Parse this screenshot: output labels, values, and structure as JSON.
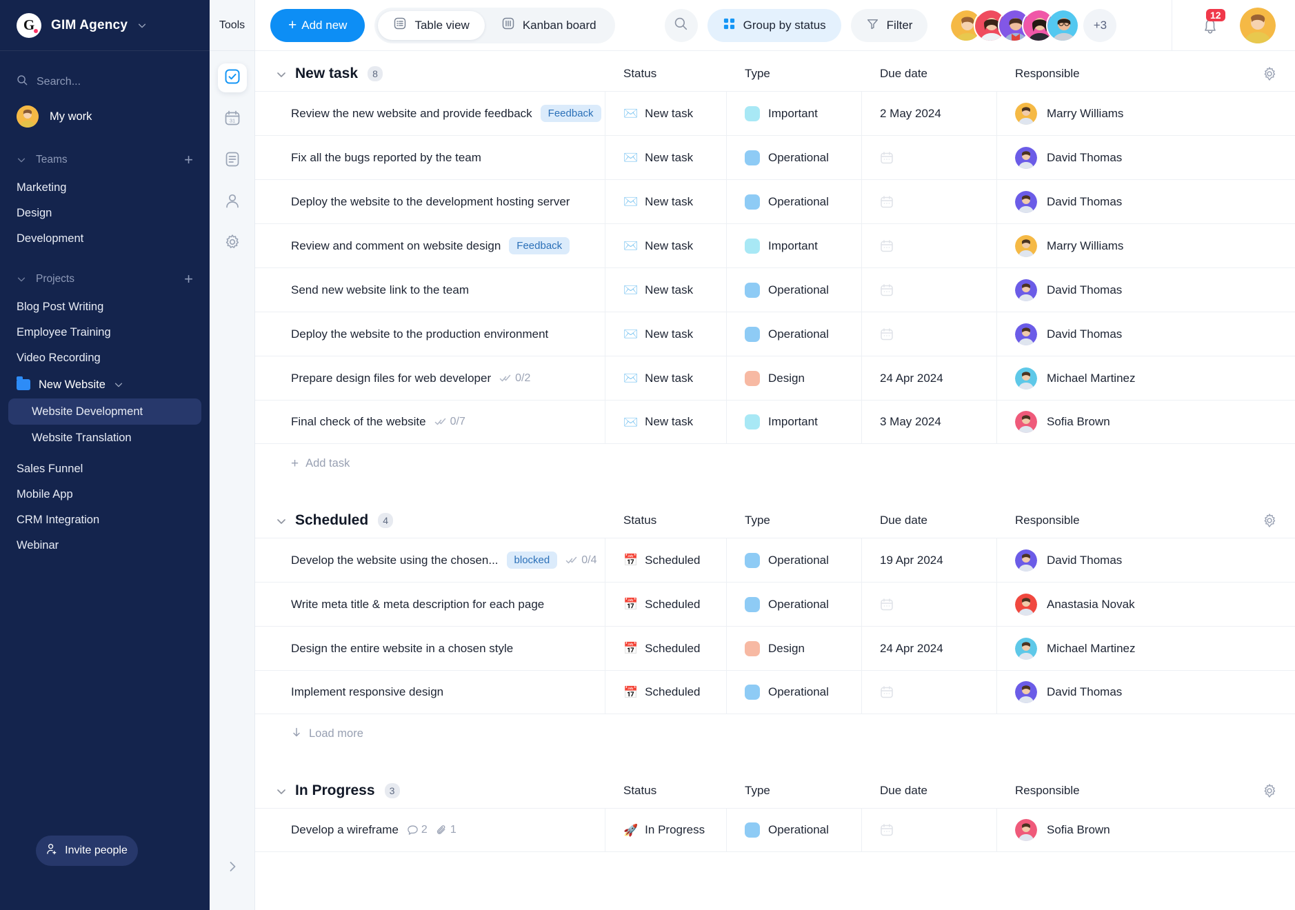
{
  "sidebar": {
    "brand": {
      "logo_letter": "G",
      "name": "GIM Agency",
      "chevron": "chevron-down-icon"
    },
    "search_placeholder": "Search...",
    "my_work": "My work",
    "teams": {
      "title": "Teams",
      "add": "+",
      "items": [
        "Marketing",
        "Design",
        "Development"
      ]
    },
    "projects": {
      "title": "Projects",
      "add": "+",
      "items": [
        "Blog Post Writing",
        "Employee Training",
        "Video Recording"
      ],
      "folder": {
        "name": "New Website",
        "children": [
          "Website Development",
          "Website Translation"
        ],
        "active_child": "Website Development"
      },
      "items_after": [
        "Sales Funnel",
        "Mobile App",
        "CRM Integration",
        "Webinar"
      ]
    },
    "invite_label": "Invite people"
  },
  "rail": {
    "title": "Tools",
    "items": [
      {
        "name": "tasks-icon",
        "selected": true
      },
      {
        "name": "calendar-icon",
        "selected": false
      },
      {
        "name": "document-icon",
        "selected": false
      },
      {
        "name": "person-icon",
        "selected": false
      },
      {
        "name": "settings-icon",
        "selected": false
      }
    ],
    "expand": "chevron-right-icon"
  },
  "topbar": {
    "add_new": "Add new",
    "views": [
      {
        "label": "Table view",
        "icon": "table-view-icon",
        "active": true
      },
      {
        "label": "Kanban board",
        "icon": "kanban-icon",
        "active": false
      }
    ],
    "search_icon": "search-icon",
    "group_by": "Group by status",
    "filter": "Filter",
    "avatars_overflow": "+3",
    "notifications_count": "12"
  },
  "columns": {
    "status": "Status",
    "type": "Type",
    "due": "Due date",
    "responsible": "Responsible",
    "settings_icon": "gear-icon"
  },
  "groups": [
    {
      "name": "New task",
      "count": "8",
      "footer": {
        "type": "add",
        "label": "Add task"
      },
      "rows": [
        {
          "task": "Review the new website and provide feedback",
          "tag": "Feedback",
          "status": "New task",
          "status_emoji": "✉️",
          "type": "Important",
          "type_color": "#a8e8f5",
          "due": "2 May 2024",
          "responsible": "Marry Williams",
          "avatar_color": "#f5b945"
        },
        {
          "task": "Fix all the bugs reported by the team",
          "status": "New task",
          "status_emoji": "✉️",
          "type": "Operational",
          "type_color": "#8ecbf5",
          "due": "",
          "responsible": "David Thomas",
          "avatar_color": "#6b5ce7"
        },
        {
          "task": "Deploy the website to the development hosting server",
          "status": "New task",
          "status_emoji": "✉️",
          "type": "Operational",
          "type_color": "#8ecbf5",
          "due": "",
          "responsible": "David Thomas",
          "avatar_color": "#6b5ce7"
        },
        {
          "task": "Review and comment on website design",
          "tag": "Feedback",
          "status": "New task",
          "status_emoji": "✉️",
          "type": "Important",
          "type_color": "#a8e8f5",
          "due": "",
          "responsible": "Marry Williams",
          "avatar_color": "#f5b945"
        },
        {
          "task": "Send new website link to the team",
          "status": "New task",
          "status_emoji": "✉️",
          "type": "Operational",
          "type_color": "#8ecbf5",
          "due": "",
          "responsible": "David Thomas",
          "avatar_color": "#6b5ce7"
        },
        {
          "task": "Deploy the website to the production environment",
          "status": "New task",
          "status_emoji": "✉️",
          "type": "Operational",
          "type_color": "#8ecbf5",
          "due": "",
          "responsible": "David Thomas",
          "avatar_color": "#6b5ce7"
        },
        {
          "task": "Prepare design files for web developer",
          "subtasks": "0/2",
          "status": "New task",
          "status_emoji": "✉️",
          "type": "Design",
          "type_color": "#f7b9a3",
          "due": "24 Apr 2024",
          "responsible": "Michael Martinez",
          "avatar_color": "#5ec8e8"
        },
        {
          "task": "Final check of the website",
          "subtasks": "0/7",
          "status": "New task",
          "status_emoji": "✉️",
          "type": "Important",
          "type_color": "#a8e8f5",
          "due": "3 May 2024",
          "responsible": "Sofia Brown",
          "avatar_color": "#ef5a7a"
        }
      ]
    },
    {
      "name": "Scheduled",
      "count": "4",
      "footer": {
        "type": "load",
        "label": "Load more"
      },
      "rows": [
        {
          "task": "Develop the website using the chosen...",
          "tag": "blocked",
          "subtasks": "0/4",
          "status": "Scheduled",
          "status_emoji": "📅",
          "type": "Operational",
          "type_color": "#8ecbf5",
          "due": "19 Apr 2024",
          "responsible": "David Thomas",
          "avatar_color": "#6b5ce7"
        },
        {
          "task": "Write meta title & meta description for each page",
          "status": "Scheduled",
          "status_emoji": "📅",
          "type": "Operational",
          "type_color": "#8ecbf5",
          "due": "",
          "responsible": "Anastasia Novak",
          "avatar_color": "#f0483f"
        },
        {
          "task": "Design the entire website in a chosen style",
          "status": "Scheduled",
          "status_emoji": "📅",
          "type": "Design",
          "type_color": "#f7b9a3",
          "due": "24 Apr 2024",
          "responsible": "Michael Martinez",
          "avatar_color": "#5ec8e8"
        },
        {
          "task": "Implement responsive design",
          "status": "Scheduled",
          "status_emoji": "📅",
          "type": "Operational",
          "type_color": "#8ecbf5",
          "due": "",
          "responsible": "David Thomas",
          "avatar_color": "#6b5ce7"
        }
      ]
    },
    {
      "name": "In Progress",
      "count": "3",
      "rows": [
        {
          "task": "Develop a wireframe",
          "comments": "2",
          "attachments": "1",
          "status": "In Progress",
          "status_emoji": "🚀",
          "type": "Operational",
          "type_color": "#8ecbf5",
          "due": "",
          "responsible": "Sofia Brown",
          "avatar_color": "#ef5a7a"
        }
      ]
    }
  ],
  "colors": {
    "accent": "#0d8ef5",
    "sidebar_bg": "#14244d",
    "tag_bg": "#dbebfb",
    "tag_text": "#2b70b8"
  }
}
